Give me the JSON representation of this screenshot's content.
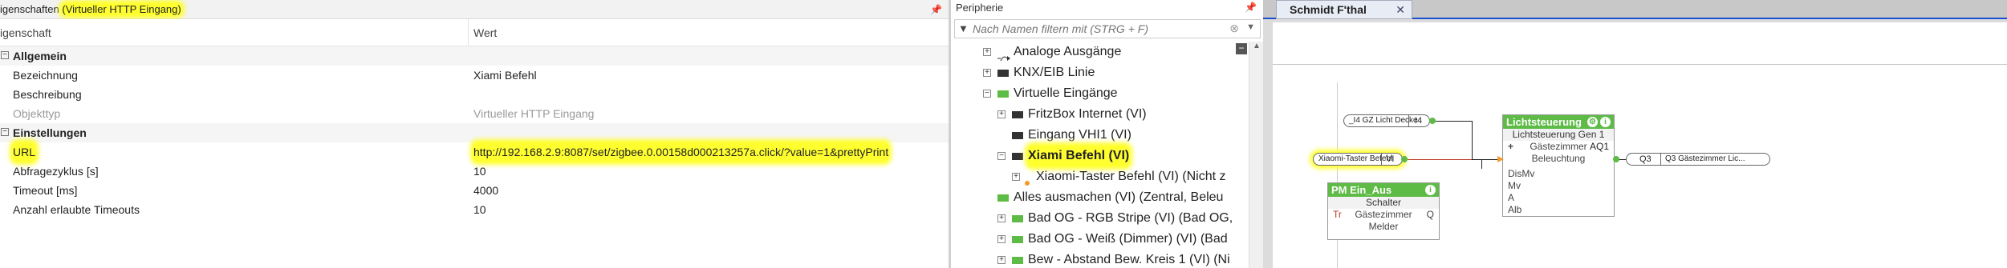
{
  "properties": {
    "title_prefix": "igenschaften",
    "title_highlight": "(Virtueller HTTP Eingang)",
    "pin_icon": "pin-icon",
    "col_name": "igenschaft",
    "col_value": "Wert",
    "categories": [
      {
        "label": "Allgemein",
        "expander": "−"
      },
      {
        "label": "Einstellungen",
        "expander": "−"
      }
    ],
    "rows": [
      {
        "key": "Bezeichnung",
        "value": "Xiami Befehl"
      },
      {
        "key": "Beschreibung",
        "value": ""
      },
      {
        "key": "Objekttyp",
        "value": "Virtueller HTTP Eingang"
      },
      {
        "key": "URL",
        "value": "http://192.168.2.9:8087/set/zigbee.0.00158d000213257a.click/?value=1&prettyPrint"
      },
      {
        "key": "Abfragezyklus [s]",
        "value": "10"
      },
      {
        "key": "Timeout [ms]",
        "value": "4000"
      },
      {
        "key": "Anzahl erlaubte Timeouts",
        "value": "10"
      }
    ]
  },
  "peripherie": {
    "title": "Peripherie",
    "filter_placeholder": "Nach Namen filtern mit (STRG + F)",
    "collapse_label": "−",
    "up_arrow": "▲",
    "items": [
      {
        "label": "Analoge Ausgänge",
        "toggle": "+"
      },
      {
        "label": "KNX/EIB Linie",
        "toggle": "+"
      },
      {
        "label": "Virtuelle Eingänge",
        "toggle": "−"
      },
      {
        "label": "FritzBox Internet (VI)",
        "toggle": "+"
      },
      {
        "label": "Eingang VHI1 (VI)",
        "toggle": ""
      },
      {
        "label": "Xiami Befehl (VI)",
        "toggle": "−"
      },
      {
        "label": "Xiaomi-Taster Befehl (VI) (Nicht z",
        "toggle": "+"
      },
      {
        "label": "Alles ausmachen (VI) (Zentral, Beleu",
        "toggle": ""
      },
      {
        "label": "Bad OG - RGB Stripe (VI) (Bad OG,",
        "toggle": "+"
      },
      {
        "label": "Bad OG - Weiß (Dimmer) (VI) (Bad",
        "toggle": "+"
      },
      {
        "label": "Bew - Abstand Bew. Kreis 1 (VI) (Ni",
        "toggle": "+"
      }
    ]
  },
  "editor": {
    "tab_label": "Schmidt F'thal",
    "tab_close": "✕",
    "pill_i4_label": "_I4 GZ Licht Decke",
    "pill_i4_right": "I4",
    "pill_vi_label": "Xiaomi-Taster Befehl",
    "pill_vi_right": "VI",
    "pill_q3_left": "Q3",
    "pill_q3_label": "Q3 Gästezimmer Lic...",
    "pm": {
      "title": "PM Ein_Aus",
      "type": "Schalter",
      "room": "Gästezimmer",
      "input_left": "Tr",
      "output_right": "Q",
      "melder": "Melder"
    },
    "licht": {
      "title": "Lichtsteuerung",
      "type": "Lichtsteuerung Gen 1",
      "room": "Gästezimmer",
      "func": "Beleuchtung",
      "plus": "+",
      "output": "AQ1",
      "inputs": [
        "DisMv",
        "Mv",
        "A",
        "Alb"
      ]
    }
  }
}
